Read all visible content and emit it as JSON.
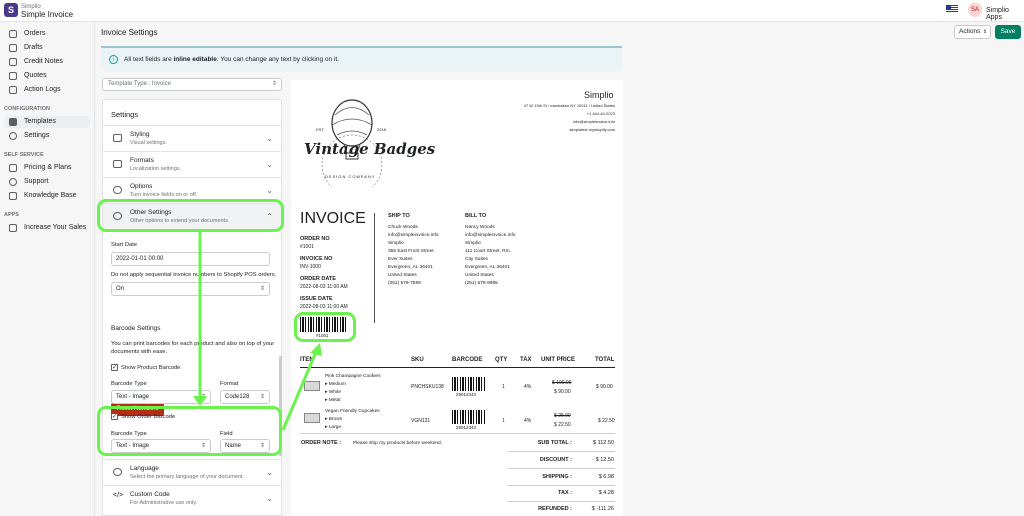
{
  "app": {
    "company": "Simplio",
    "name": "Simple Invoice",
    "store": "Simplio Apps",
    "avatar": "SA"
  },
  "nav": {
    "items": [
      "Orders",
      "Drafts",
      "Credit Notes",
      "Quotes",
      "Action Logs"
    ],
    "config_h": "CONFIGURATION",
    "config": [
      "Templates",
      "Settings"
    ],
    "self_h": "SELF SERVICE",
    "self": [
      "Pricing & Plans",
      "Support",
      "Knowledge Base"
    ],
    "apps_h": "APPS",
    "apps": [
      "Increase Your Sales"
    ]
  },
  "page": {
    "title": "Invoice Settings",
    "actions": "Actions",
    "save": "Save",
    "banner_pre": "All text fields are ",
    "banner_b": "inline editable",
    "banner_post": ". You can change any text by clicking on it.",
    "template_type": "Template Type : Invoice"
  },
  "settings": {
    "heading": "Settings",
    "items": [
      {
        "t": "Styling",
        "s": "Visual settings."
      },
      {
        "t": "Formats",
        "s": "Localization settings."
      },
      {
        "t": "Options",
        "s": "Turn invoice fields on or off."
      },
      {
        "t": "Other Settings",
        "s": "Other options to extend your documents."
      }
    ],
    "start_date_label": "Start Date",
    "start_date": "2022-01-01 00:00",
    "pos_label": "Do not apply sequential invoice numbers to Shopify POS orders.",
    "pos_value": "On",
    "reset": "Reset Numbers",
    "barcode_h": "Barcode Settings",
    "barcode_desc1": "You can print barcodes for each product and also on top of your",
    "barcode_desc2": "documents with ease.",
    "show_product": "Show Product Barcode",
    "type_label": "Barcode Type",
    "type_value": "Text - Image",
    "format_label": "Format",
    "format_value": "Code128",
    "show_order": "Show Order Barcode",
    "type2_value": "Text - Image",
    "field_label": "Field",
    "field_value": "Name",
    "lang": {
      "t": "Language",
      "s": "Select the primary language of your document."
    },
    "custom": {
      "t": "Custom Code",
      "s": "For Administrative use only."
    }
  },
  "invoice": {
    "company": "Simplio",
    "addr": [
      "47 W 13th St / manhattan NY 10011 / United States",
      "+1 444-44-0223",
      "info@simpleinvoice.info",
      "simplotest.myshopify.com"
    ],
    "logo_a": "EST.",
    "logo_b": "2018",
    "logo_main": "Vintage Badges",
    "logo_sub": "DESIGN COMPANY",
    "title": "INVOICE",
    "order_no_l": "ORDER NO",
    "order_no": "#1001",
    "inv_no_l": "INVOICE NO",
    "inv_no": "INV-1000",
    "order_date_l": "ORDER DATE",
    "order_date": "2022-08-03 11:00 AM",
    "issue_date_l": "ISSUE DATE",
    "issue_date": "2022-08-03 11:00 AM",
    "barcode_text": "#1001",
    "ship_h": "SHIP TO",
    "ship": [
      "Chuck Woods",
      "info@simpleinvoice.info",
      "Simplio",
      "355 East Front Street",
      "Ever Suites",
      "Evergreen, AL 36401",
      "United States",
      "(251) 578-7599"
    ],
    "bill_h": "BILL TO",
    "bill": [
      "Nancy Woods",
      "info@simpleinvoice.info",
      "Simplio",
      "111 Court Street, Rm.",
      "City Suites",
      "Evergreen, AL 36401",
      "United States",
      "(251) 578-9985"
    ],
    "cols": [
      "ITEM",
      "SKU",
      "BARCODE",
      "QTY",
      "TAX",
      "UNIT PRICE",
      "TOTAL"
    ],
    "rows": [
      {
        "name": "Pink Champagne Cookies",
        "opts": [
          "Medium",
          "White",
          "Metal"
        ],
        "sku": "PNCHSKU138",
        "bc": "29012343",
        "qty": "1",
        "tax": "4%",
        "old": "$ 100.00",
        "unit": "$ 90.00",
        "total": "$ 90.00"
      },
      {
        "name": "Vegan Friendly Cupcakes",
        "opts": [
          "Brown",
          "Large"
        ],
        "sku": "VGN131",
        "bc": "29012343",
        "qty": "1",
        "tax": "4%",
        "old": "$ 25.00",
        "unit": "$ 22.50",
        "total": "$ 22.50"
      }
    ],
    "note_l": "ORDER NOTE :",
    "note": "Please ship my products before weekend.",
    "totals": [
      {
        "l": "SUB TOTAL :",
        "v": "$ 112.50"
      },
      {
        "l": "DISCOUNT :",
        "v": "- $ 12.50"
      },
      {
        "l": "SHIPPING :",
        "v": "$ 6.98"
      },
      {
        "l": "TAX :",
        "v": "$ 4.28"
      },
      {
        "l": "REFUNDED :",
        "v": "$ -111.26"
      }
    ]
  }
}
